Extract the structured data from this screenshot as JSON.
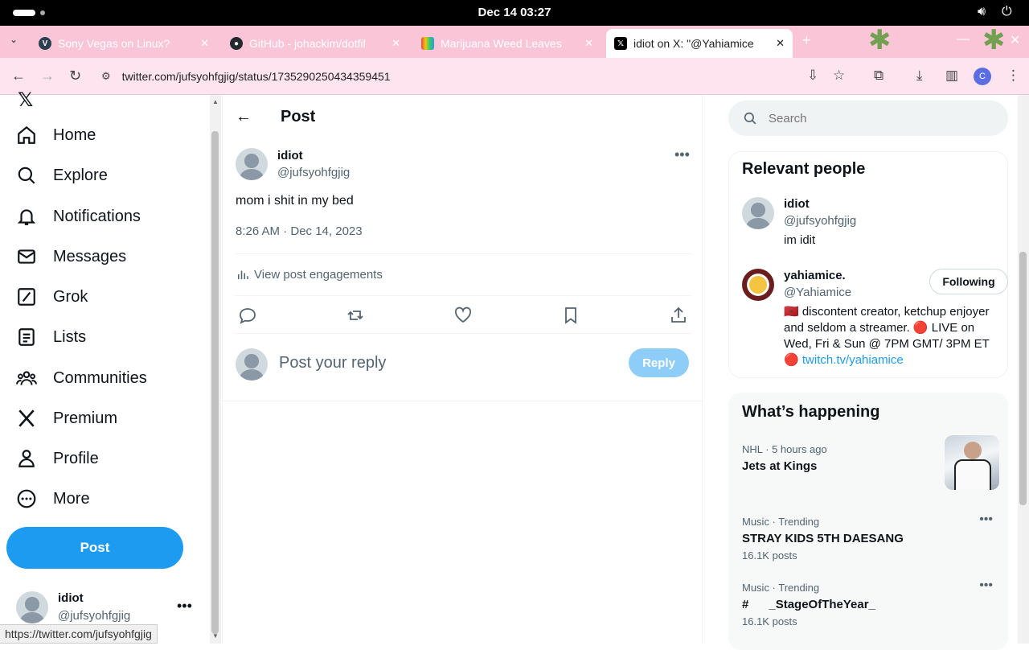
{
  "system_bar": {
    "clock": "Dec 14  03:27"
  },
  "browser": {
    "tabs": [
      {
        "title": "Sony Vegas on Linux?",
        "favicon": "V",
        "active": false
      },
      {
        "title": "GitHub - johackim/dotfil",
        "favicon": "github",
        "active": false
      },
      {
        "title": "Marijuana Weed Leaves",
        "favicon": "rainbow",
        "active": false
      },
      {
        "title": "idiot on X: \"@Yahiamice",
        "favicon": "X",
        "active": true
      }
    ],
    "url": "twitter.com/jufsyohfgjig/status/1735290250434359451",
    "profile_initial": "C"
  },
  "sidebar": {
    "items": [
      {
        "label": "Home",
        "icon": "home-icon"
      },
      {
        "label": "Explore",
        "icon": "search-icon"
      },
      {
        "label": "Notifications",
        "icon": "bell-icon"
      },
      {
        "label": "Messages",
        "icon": "mail-icon"
      },
      {
        "label": "Grok",
        "icon": "grok-icon"
      },
      {
        "label": "Lists",
        "icon": "list-icon"
      },
      {
        "label": "Communities",
        "icon": "communities-icon"
      },
      {
        "label": "Premium",
        "icon": "x-icon"
      },
      {
        "label": "Profile",
        "icon": "person-icon"
      },
      {
        "label": "More",
        "icon": "more-circle-icon"
      }
    ],
    "post_button": "Post",
    "account": {
      "name": "idiot",
      "handle": "@jufsyohfgjig"
    }
  },
  "status_link": "https://twitter.com/jufsyohfgjig",
  "main": {
    "header_title": "Post",
    "tweet": {
      "author_name": "idiot",
      "author_handle": "@jufsyohfgjig",
      "text": "mom i shit in my bed",
      "timestamp": "8:26 AM · Dec 14, 2023",
      "engagements_label": "View post engagements"
    },
    "reply": {
      "placeholder": "Post your reply",
      "button": "Reply"
    }
  },
  "right": {
    "search_placeholder": "Search",
    "relevant_people": {
      "title": "Relevant people",
      "people": [
        {
          "name": "idiot",
          "handle": "@jufsyohfgjig",
          "bio": "im idit"
        },
        {
          "name": "yahiamice.",
          "handle": "@Yahiamice",
          "bio_prefix": "🇲🇦 discontent creator, ketchup enjoyer and seldom a streamer. 🔴 LIVE on Wed, Fri & Sun @ 7PM GMT/ 3PM ET 🔴 ",
          "bio_link": "twitch.tv/yahiamice",
          "follow_label": "Following"
        }
      ]
    },
    "whats_happening": {
      "title": "What’s happening",
      "trends": [
        {
          "meta": "NHL · 5 hours ago",
          "title": "Jets at Kings",
          "count": ""
        },
        {
          "meta": "Music · Trending",
          "title": "STRAY KIDS 5TH DAESANG",
          "count": "16.1K posts"
        },
        {
          "meta": "Music · Trending",
          "title": "#      _StageOfTheYear_",
          "count": "16.1K posts"
        }
      ]
    }
  }
}
